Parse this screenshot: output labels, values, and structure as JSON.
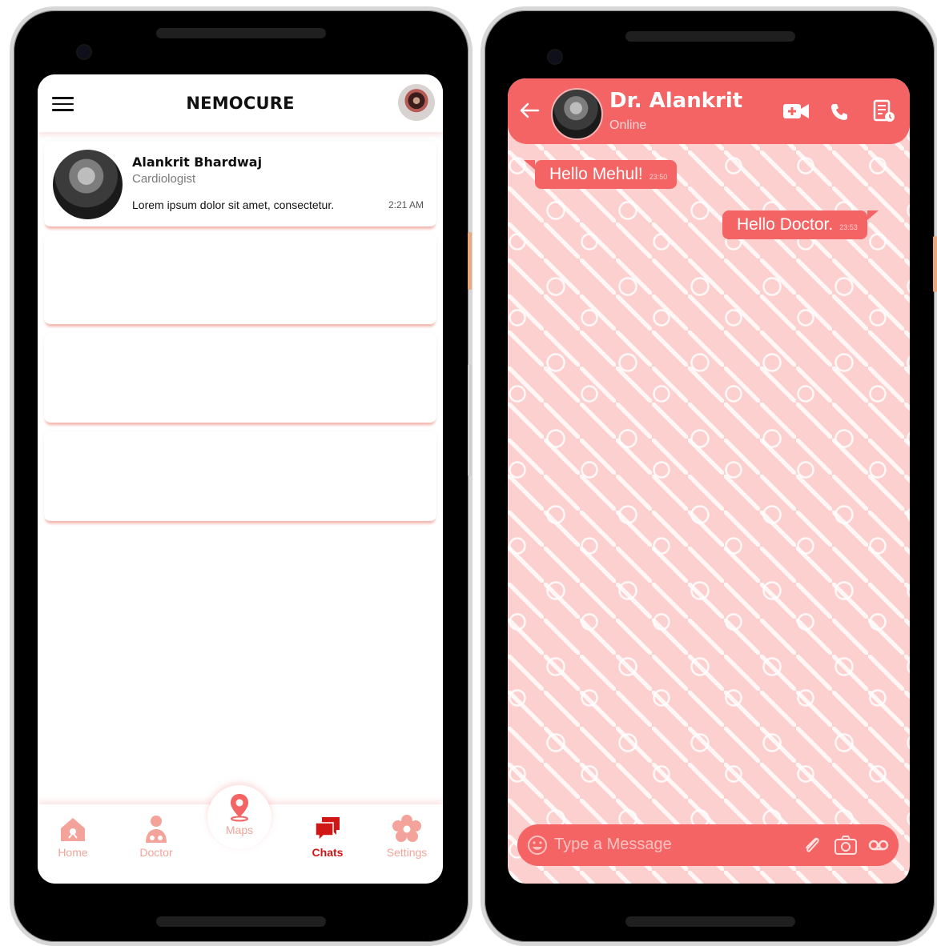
{
  "left_screen": {
    "app_title": "NEMOCURE",
    "chat_list": [
      {
        "name": "Alankrit Bhardwaj",
        "role": "Cardiologist",
        "last_message": "Lorem ipsum dolor sit amet, consectetur.",
        "time": "2:21 AM"
      }
    ],
    "nav": {
      "home": "Home",
      "doctor": "Doctor",
      "maps": "Maps",
      "chats": "Chats",
      "settings": "Settings",
      "active": "chats"
    }
  },
  "right_screen": {
    "contact_name": "Dr. Alankrit",
    "contact_status": "Online",
    "messages": [
      {
        "direction": "incoming",
        "text": "Hello Mehul!",
        "time": "23:50"
      },
      {
        "direction": "outgoing",
        "text": "Hello Doctor.",
        "time": "23:53"
      }
    ],
    "input_placeholder": "Type a Message"
  },
  "colors": {
    "accent": "#f46464",
    "accent_dark": "#d11616",
    "nav_inactive": "#f3a39a",
    "chat_background": "#fdd0d0"
  },
  "icons": {
    "header": [
      "video-call-icon",
      "phone-icon",
      "prescription-icon"
    ],
    "input": [
      "emoji-icon",
      "attach-icon",
      "camera-icon",
      "voice-icon"
    ],
    "nav": [
      "home-icon",
      "doctor-icon",
      "map-pin-icon",
      "chat-icon",
      "settings-icon"
    ]
  }
}
